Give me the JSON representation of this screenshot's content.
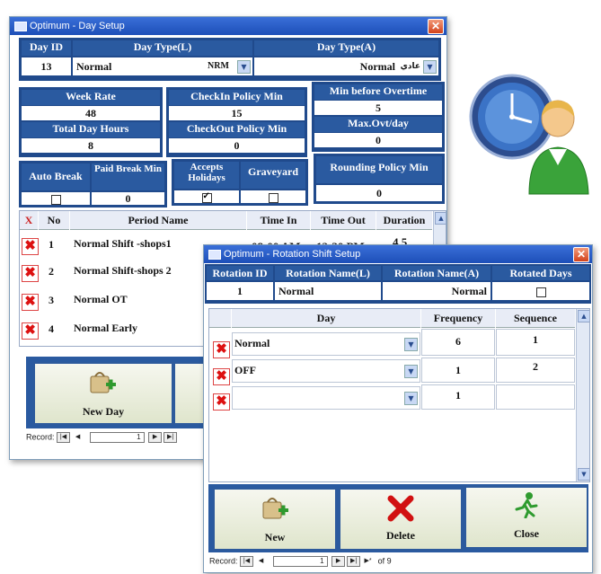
{
  "day_setup": {
    "title": "Optimum - Day Setup",
    "close_symbol": "✕",
    "headers": {
      "day_id": "Day ID",
      "day_type_l": "Day Type(L)",
      "day_type_a": "Day Type(A)",
      "week_rate": "Week Rate",
      "total_day_hours": "Total Day Hours",
      "checkin_policy_min": "CheckIn Policy Min",
      "checkout_policy_min": "CheckOut Policy Min",
      "min_before_overtime": "Min before Overtime",
      "max_ovt_day": "Max.Ovt/day",
      "auto_break": "Auto Break",
      "paid_break_min": "Paid Break Min",
      "accepts_holidays": "Accepts Holidays",
      "graveyard": "Graveyard",
      "rounding_policy_min": "Rounding Policy Min"
    },
    "values": {
      "day_id": "13",
      "day_type_l": "Normal",
      "day_type_l_code": "NRM",
      "day_type_a": "Normal",
      "day_type_a_code": "عادي",
      "week_rate": "48",
      "total_day_hours": "8",
      "checkin_policy_min": "15",
      "checkout_policy_min": "0",
      "min_before_overtime": "5",
      "max_ovt_day": "0",
      "paid_break_min": "0",
      "rounding_policy_min": "0",
      "auto_break_checked": false,
      "accepts_holidays_checked": true,
      "graveyard_checked": false
    },
    "grid": {
      "columns": [
        "X",
        "No",
        "Period Name",
        "Time In",
        "Time Out",
        "Duration"
      ],
      "rows": [
        {
          "no": "1",
          "name": "Normal Shift -shops1",
          "time_in": "08:00 AM",
          "time_out": "12:30 PM",
          "duration": "4.5"
        },
        {
          "no": "2",
          "name": "Normal Shift-shops 2",
          "time_in": "",
          "time_out": "",
          "duration": ""
        },
        {
          "no": "3",
          "name": "Normal OT",
          "time_in": "",
          "time_out": "",
          "duration": ""
        },
        {
          "no": "4",
          "name": "Normal Early",
          "time_in": "",
          "time_out": "",
          "duration": ""
        }
      ]
    },
    "new_day_label": "New Day",
    "record_label": "Record:",
    "record_value": "1"
  },
  "rotation": {
    "title": "Optimum - Rotation Shift Setup",
    "close_symbol": "✕",
    "headers": {
      "rotation_id": "Rotation ID",
      "rotation_name_l": "Rotation Name(L)",
      "rotation_name_a": "Rotation Name(A)",
      "rotated_days": "Rotated Days"
    },
    "values": {
      "rotation_id": "1",
      "rotation_name_l": "Normal",
      "rotation_name_a": "Normal",
      "rotated_days_checked": false
    },
    "grid": {
      "columns": [
        "Day",
        "Frequency",
        "Sequence"
      ],
      "rows": [
        {
          "day": "Normal",
          "frequency": "6",
          "sequence": "1"
        },
        {
          "day": "OFF",
          "frequency": "1",
          "sequence": "2"
        },
        {
          "day": "",
          "frequency": "1",
          "sequence": ""
        }
      ]
    },
    "buttons": {
      "new": "New",
      "delete": "Delete",
      "close": "Close"
    },
    "record_label": "Record:",
    "record_value": "1",
    "record_of": "of 9"
  },
  "icons": {
    "clock": "clock-icon",
    "user": "user-icon",
    "delete_row": "delete-row-icon",
    "new_record": "new-record-icon",
    "delete_x": "delete-icon",
    "run": "exit-icon"
  },
  "colors": {
    "title_blue": "#1d4fb8",
    "panel_blue": "#204a8c",
    "header_blue": "#2a5aa0",
    "delete_red": "#d11111",
    "close_green": "#2f9b2f",
    "button_bg": "#eef0e0"
  }
}
